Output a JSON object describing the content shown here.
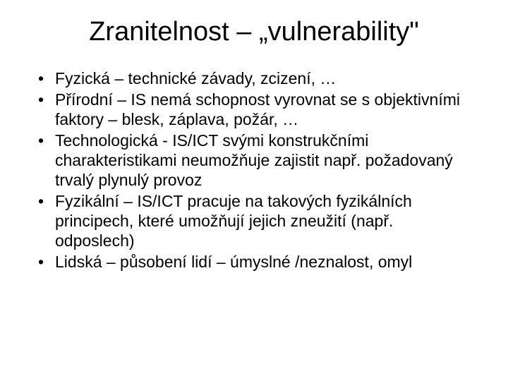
{
  "title": "Zranitelnost – „vulnerability\"",
  "bullets": [
    "Fyzická – technické závady, zcizení, …",
    "Přírodní – IS nemá schopnost vyrovnat se s objektivními faktory – blesk, záplava, požár, …",
    "Technologická - IS/ICT svými konstrukčními charakteristikami neumožňuje zajistit např. požadovaný trvalý plynulý provoz",
    "Fyzikální – IS/ICT pracuje na takových fyzikálních principech, které umožňují jejich zneužití (např. odposlech)",
    "Lidská – působení lidí – úmyslné /neznalost, omyl"
  ]
}
